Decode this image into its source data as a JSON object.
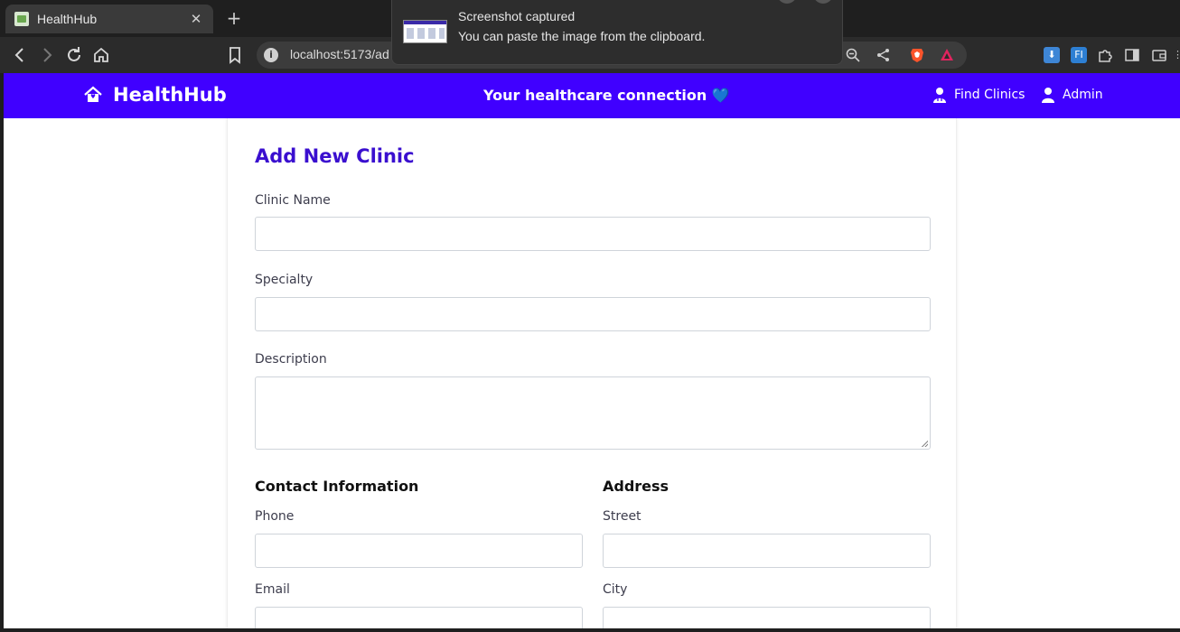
{
  "browser": {
    "tab": {
      "title": "HealthHub"
    },
    "url": "localhost:5173/ad"
  },
  "notification": {
    "title": "Screenshot captured",
    "body": "You can paste the image from the clipboard."
  },
  "app": {
    "brand": "HealthHub",
    "tagline": "Your healthcare connection",
    "tagline_emoji": "💙",
    "nav": [
      {
        "label": "Find Clinics"
      },
      {
        "label": "Admin"
      }
    ]
  },
  "form": {
    "title": "Add New Clinic",
    "fields": {
      "clinic_name": {
        "label": "Clinic Name",
        "value": ""
      },
      "specialty": {
        "label": "Specialty",
        "value": ""
      },
      "description": {
        "label": "Description",
        "value": ""
      }
    },
    "contact": {
      "title": "Contact Information",
      "phone": {
        "label": "Phone",
        "value": ""
      },
      "email": {
        "label": "Email",
        "value": ""
      }
    },
    "address": {
      "title": "Address",
      "street": {
        "label": "Street",
        "value": ""
      },
      "city": {
        "label": "City",
        "value": ""
      }
    }
  },
  "colors": {
    "header": "#4000ff",
    "title": "#3a0fcf"
  }
}
